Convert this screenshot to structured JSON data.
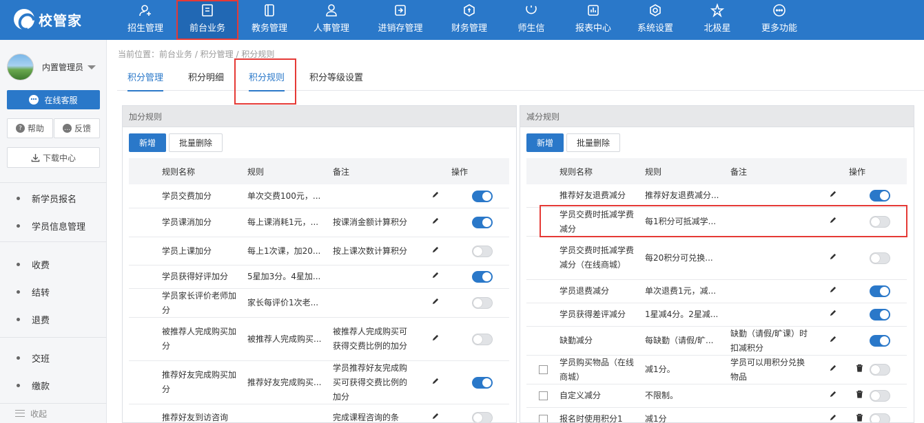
{
  "app": {
    "logo_text": "校管家"
  },
  "nav": {
    "items": [
      {
        "label": "招生管理",
        "icon": "user-add-icon"
      },
      {
        "label": "前台业务",
        "icon": "desk-icon"
      },
      {
        "label": "教务管理",
        "icon": "book-icon"
      },
      {
        "label": "人事管理",
        "icon": "person-icon"
      },
      {
        "label": "进销存管理",
        "icon": "inventory-icon"
      },
      {
        "label": "财务管理",
        "icon": "finance-icon"
      },
      {
        "label": "师生信",
        "icon": "message-icon"
      },
      {
        "label": "报表中心",
        "icon": "report-icon"
      },
      {
        "label": "系统设置",
        "icon": "settings-icon"
      },
      {
        "label": "北极星",
        "icon": "star-icon"
      },
      {
        "label": "更多功能",
        "icon": "more-icon"
      }
    ]
  },
  "sidebar": {
    "user_name": "内置管理员",
    "service_label": "在线客服",
    "help_label": "帮助",
    "feedback_label": "反馈",
    "download_label": "下载中心",
    "items": [
      "新学员报名",
      "学员信息管理",
      "收费",
      "结转",
      "退费",
      "交班",
      "缴款"
    ],
    "collapse_label": "收起"
  },
  "breadcrumb": "当前位置：前台业务 / 积分管理 / 积分规则",
  "tabs": [
    "积分管理",
    "积分明细",
    "积分规则",
    "积分等级设置"
  ],
  "columns": {
    "name": "规则名称",
    "rule": "规则",
    "note": "备注",
    "action": "操作"
  },
  "buttons": {
    "add": "新增",
    "batch_delete": "批量删除"
  },
  "add_panel": {
    "title": "加分规则",
    "rows": [
      {
        "name": "学员交费加分",
        "rule": "单次交费100元，...",
        "note": "",
        "enabled": true
      },
      {
        "name": "学员课消加分",
        "rule": "每上课消耗1元，...",
        "note": "按课消金额计算积分",
        "enabled": true
      },
      {
        "name": "学员上课加分",
        "rule": "每上1次课，加20...",
        "note": "按上课次数计算积分",
        "enabled": false
      },
      {
        "name": "学员获得好评加分",
        "rule": "5星加3分。4星加...",
        "note": "",
        "enabled": true
      },
      {
        "name": "学员家长评价老师加分",
        "rule": "家长每评价1次老...",
        "note": "",
        "enabled": false
      },
      {
        "name": "被推荐人完成购买加分",
        "rule": "被推荐人完成购买...",
        "note": "被推荐人完成购买可获得交费比例的加分",
        "enabled": false
      },
      {
        "name": "推荐好友完成购买加分",
        "rule": "推荐好友完成购买...",
        "note": "学员推荐好友完成购买可获得交费比例的加分",
        "enabled": true
      },
      {
        "name": "推荐好友到访咨询",
        "rule": "",
        "note": "完成课程咨询的条",
        "enabled": false
      }
    ]
  },
  "sub_panel": {
    "title": "减分规则",
    "rows": [
      {
        "name": "推荐好友退费减分",
        "rule": "推荐好友退费减分...",
        "note": "",
        "enabled": true,
        "custom": false
      },
      {
        "name": "学员交费时抵减学费减分",
        "rule": "每1积分可抵减学...",
        "note": "",
        "enabled": false,
        "custom": false
      },
      {
        "name": "学员交费时抵减学费减分（在线商城）",
        "rule": "每20积分可兑换...",
        "note": "",
        "enabled": false,
        "custom": false
      },
      {
        "name": "学员退费减分",
        "rule": "单次退费1元，减...",
        "note": "",
        "enabled": true,
        "custom": false
      },
      {
        "name": "学员获得差评减分",
        "rule": "1星减4分。2星减...",
        "note": "",
        "enabled": true,
        "custom": false
      },
      {
        "name": "缺勤减分",
        "rule": "每缺勤（请假/旷...",
        "note": "缺勤（请假/旷课）时扣减积分",
        "enabled": true,
        "custom": false
      },
      {
        "name": "学员购买物品（在线商城）",
        "rule": "减1分。",
        "note": "学员可以用积分兑换物品",
        "enabled": false,
        "custom": true
      },
      {
        "name": "自定义减分",
        "rule": "不限制。",
        "note": "",
        "enabled": false,
        "custom": true
      },
      {
        "name": "报名时使用积分1",
        "rule": "减1分",
        "note": "",
        "enabled": false,
        "custom": true
      }
    ]
  }
}
